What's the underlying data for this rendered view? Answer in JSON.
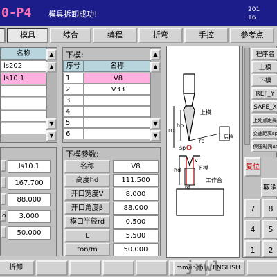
{
  "header": {
    "app_title": "0-P4",
    "status_message": "模具拆卸成功!",
    "clock_line1": "201",
    "clock_line2": "16"
  },
  "tabs": [
    {
      "label": "模具",
      "active": true
    },
    {
      "label": "综合",
      "active": false
    },
    {
      "label": "编程",
      "active": false
    },
    {
      "label": "折弯",
      "active": false
    },
    {
      "label": "手控",
      "active": false
    },
    {
      "label": "参考点",
      "active": false
    }
  ],
  "upper_list": {
    "col_name": "名称",
    "rows": [
      "ls202",
      "ls10.1",
      "",
      "",
      "",
      ""
    ]
  },
  "lower_list": {
    "title": "下模:",
    "col_no": "序号",
    "col_name": "名称",
    "rows": [
      {
        "no": "1",
        "name": "V8"
      },
      {
        "no": "2",
        "name": "V33"
      },
      {
        "no": "3",
        "name": ""
      },
      {
        "no": "4",
        "name": ""
      },
      {
        "no": "5",
        "name": ""
      },
      {
        "no": "6",
        "name": ""
      }
    ]
  },
  "upper_params": {
    "values": [
      "ls10.1",
      "167.700",
      "88.000",
      "3.000",
      "50.000"
    ],
    "row4_label_fragment": "o"
  },
  "lower_params": {
    "title": "下模参数:",
    "rows": [
      {
        "label": "名称",
        "value": "V8"
      },
      {
        "label": "高度hd",
        "value": "111.500"
      },
      {
        "label": "开口宽度V",
        "value": "8.000"
      },
      {
        "label": "开口角度β",
        "value": "88.000"
      },
      {
        "label": "模口半径rd",
        "value": "0.500"
      },
      {
        "label": "L",
        "value": "5.500"
      },
      {
        "label": "ton/m",
        "value": "50.000"
      }
    ]
  },
  "diagram": {
    "labels": {
      "tdc": "TDC",
      "hp": "hp",
      "rp": "rp",
      "sp": "sp",
      "upper": "上模",
      "backgauge": "后档",
      "hd": "hd",
      "v": "v",
      "rd": "rd",
      "lower": "下模",
      "table": "工作台"
    }
  },
  "right_panel": {
    "items": [
      "程序名",
      "上模",
      "下模",
      "REF_Y",
      "SAFE_X",
      "上死点距离TD",
      "变速距离sp",
      "保压时间At"
    ],
    "reset_label": "复位",
    "cancel_label": "取消",
    "keys": [
      "7",
      "4",
      "1",
      "8",
      "5",
      "2"
    ]
  },
  "bottom": {
    "buttons": [
      "折卸",
      "",
      "",
      "",
      "",
      "",
      "mm/inch",
      "ENGLISH",
      ""
    ],
    "watermark": "jxwl"
  },
  "colors": {
    "titlebar": "#1c1c8a",
    "title_text": "#ff6fb0",
    "selected_row": "#ffb0e0",
    "table_header": "#b8d4dc",
    "reset_text": "#d00000",
    "diagram_accent": "#cc2a2a"
  }
}
